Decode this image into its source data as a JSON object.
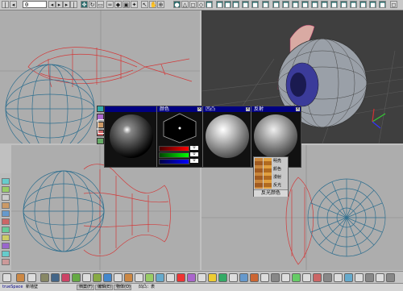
{
  "toolbar": {
    "frame_value": "0",
    "buttons": [
      "play",
      "pause",
      "rewind",
      "prev",
      "next",
      "end",
      "move",
      "rotate",
      "scale",
      "link",
      "select",
      "camera",
      "light",
      "render"
    ]
  },
  "viewports": {
    "top_left": {
      "label": ""
    },
    "top_right": {
      "label": ""
    },
    "bottom_left": {
      "label": ""
    },
    "bottom_right": {
      "label": ""
    }
  },
  "material_editor": {
    "panes": [
      {
        "title": "",
        "icon": "sphere-swatch"
      },
      {
        "title": "颜色",
        "icon": "color-hexagon"
      },
      {
        "title": "凹凸",
        "icon": "bump-sphere"
      },
      {
        "title": "反射",
        "icon": "reflect-sphere"
      }
    ],
    "rgb": [
      {
        "channel": "red",
        "value": "0"
      },
      {
        "channel": "green",
        "value": "0"
      },
      {
        "channel": "blue",
        "value": "0"
      }
    ]
  },
  "palette": {
    "items": [
      "明亮",
      "颜色",
      "漫射",
      "反光"
    ],
    "footer": "反光颜色"
  },
  "status": {
    "app_label": "trueSpace",
    "app_suffix": "新墙壁",
    "center": "凹凸：表",
    "buttons": [
      "档案(F)",
      "编辑(E)",
      "物体(O)"
    ]
  },
  "colors": {
    "wire_red": "#d23a3a",
    "wire_blue": "#2f6f8f",
    "eye_iris": "#3b3b9a",
    "titlebar": "#000080"
  }
}
